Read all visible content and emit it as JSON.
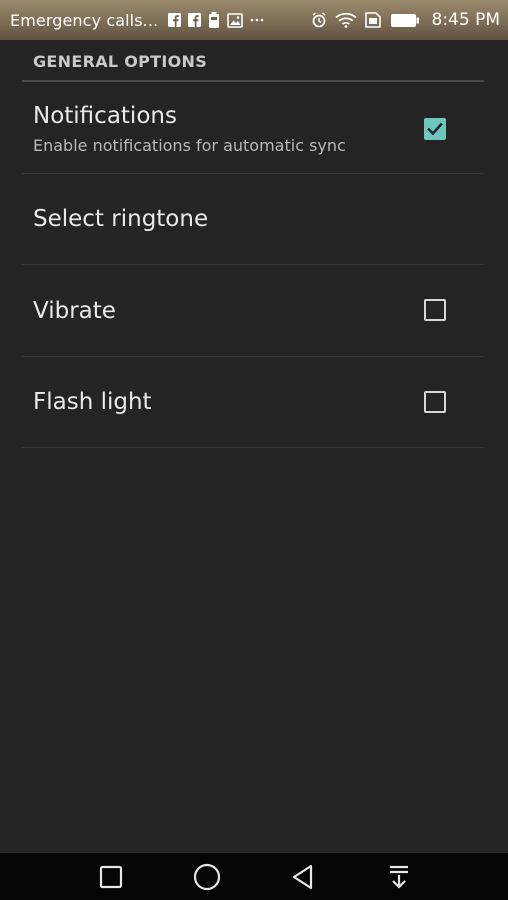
{
  "status_bar": {
    "carrier_text": "Emergency calls...",
    "notification_icons": [
      "facebook-icon",
      "facebook-icon",
      "battery-saver-icon",
      "image-icon",
      "more-dots-icon"
    ],
    "system_icons": [
      "alarm-icon",
      "wifi-icon",
      "sim-icon",
      "battery-icon"
    ],
    "time": "8:45 PM"
  },
  "settings": {
    "section_header": "GENERAL OPTIONS",
    "items": [
      {
        "title": "Notifications",
        "summary": "Enable notifications for automatic sync",
        "has_checkbox": true,
        "checked": true
      },
      {
        "title": "Select ringtone",
        "has_checkbox": false
      },
      {
        "title": "Vibrate",
        "has_checkbox": true,
        "checked": false
      },
      {
        "title": "Flash light",
        "has_checkbox": true,
        "checked": false
      }
    ]
  },
  "nav_bar": {
    "buttons": [
      "recents-square-icon",
      "home-circle-icon",
      "back-triangle-icon",
      "notification-pull-icon"
    ]
  },
  "colors": {
    "background": "#242424",
    "accent_checkbox": "#6ec7bd",
    "nav_bar": "#050505",
    "status_bar": "#7c6d55"
  }
}
